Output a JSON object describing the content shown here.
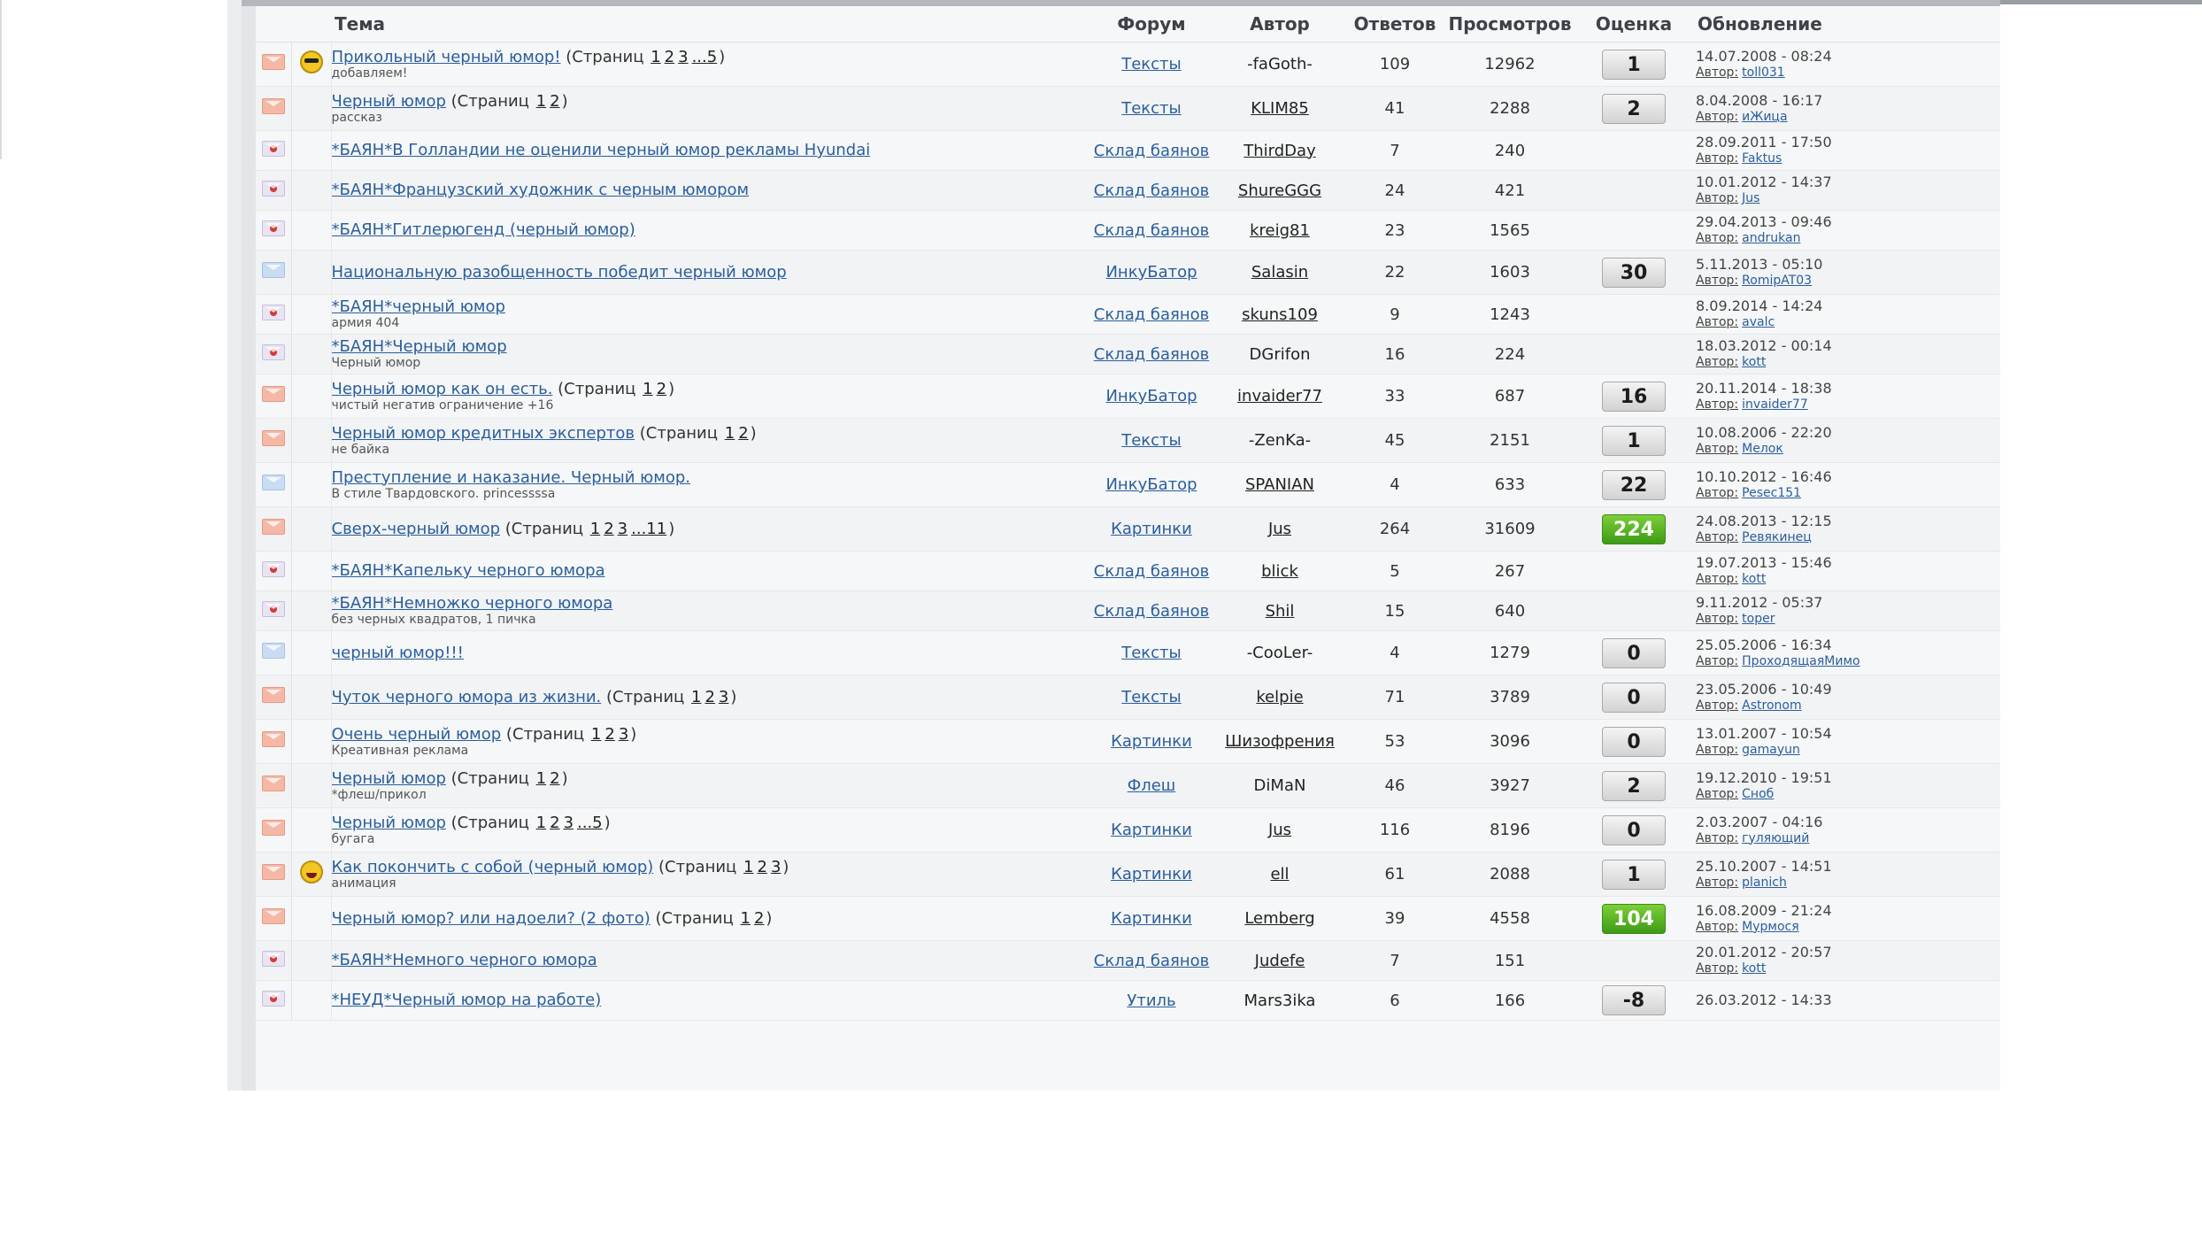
{
  "table": {
    "headers": {
      "topic": "Тема",
      "forum": "Форум",
      "author": "Автор",
      "replies": "Ответов",
      "views": "Просмотров",
      "rating": "Оценка",
      "updated": "Обновление"
    },
    "pages_word": "(Страниц",
    "author_prefix": "Автор:",
    "rows": [
      {
        "icon": "hot",
        "emoji": "cool",
        "title": "Прикольный черный юмор!",
        "pages": [
          "1",
          "2",
          "3",
          "...5"
        ],
        "subtitle": "добавляем!",
        "forum": "Тексты",
        "author": "-faGoth-",
        "author_link": false,
        "replies": "109",
        "views": "12962",
        "rating": "1",
        "rating_style": "gray",
        "updated": "14.07.2008 - 08:24",
        "updated_by": "toll031"
      },
      {
        "icon": "hot",
        "emoji": "",
        "title": "Черный юмор",
        "pages": [
          "1",
          "2"
        ],
        "subtitle": "рассказ",
        "forum": "Тексты",
        "author": "KLIM85",
        "author_link": true,
        "replies": "41",
        "views": "2288",
        "rating": "2",
        "rating_style": "gray",
        "updated": "8.04.2008 - 16:17",
        "updated_by": "иЖица"
      },
      {
        "icon": "moved",
        "emoji": "",
        "title": "*БАЯН*В Голландии не оценили черный юмор рекламы Hyundai",
        "pages": [],
        "subtitle": "",
        "forum": "Склад баянов",
        "author": "ThirdDay",
        "author_link": true,
        "replies": "7",
        "views": "240",
        "rating": "",
        "rating_style": "",
        "updated": "28.09.2011 - 17:50",
        "updated_by": "Faktus"
      },
      {
        "icon": "moved",
        "emoji": "",
        "title": "*БАЯН*Французский художник с черным юмором",
        "pages": [],
        "subtitle": "",
        "forum": "Склад баянов",
        "author": "ShureGGG",
        "author_link": true,
        "replies": "24",
        "views": "421",
        "rating": "",
        "rating_style": "",
        "updated": "10.01.2012 - 14:37",
        "updated_by": "Jus"
      },
      {
        "icon": "moved",
        "emoji": "",
        "title": "*БАЯН*Гитлерюгенд (черный юмор)",
        "pages": [],
        "subtitle": "",
        "forum": "Склад баянов",
        "author": "kreig81",
        "author_link": true,
        "replies": "23",
        "views": "1565",
        "rating": "",
        "rating_style": "",
        "updated": "29.04.2013 - 09:46",
        "updated_by": "andrukan"
      },
      {
        "icon": "new",
        "emoji": "",
        "title": "Национальную разобщенность победит черный юмор",
        "pages": [],
        "subtitle": "",
        "forum": "ИнкуБатор",
        "author": "Salasin",
        "author_link": true,
        "replies": "22",
        "views": "1603",
        "rating": "30",
        "rating_style": "gray",
        "updated": "5.11.2013 - 05:10",
        "updated_by": "RomipAT03"
      },
      {
        "icon": "moved",
        "emoji": "",
        "title": "*БАЯН*черный юмор",
        "pages": [],
        "subtitle": "армия 404",
        "forum": "Склад баянов",
        "author": "skuns109",
        "author_link": true,
        "replies": "9",
        "views": "1243",
        "rating": "",
        "rating_style": "",
        "updated": "8.09.2014 - 14:24",
        "updated_by": "avalc"
      },
      {
        "icon": "moved",
        "emoji": "",
        "title": "*БАЯН*Черный юмор",
        "pages": [],
        "subtitle": "Черный юмор",
        "forum": "Склад баянов",
        "author": "DGrifon",
        "author_link": false,
        "replies": "16",
        "views": "224",
        "rating": "",
        "rating_style": "",
        "updated": "18.03.2012 - 00:14",
        "updated_by": "kott"
      },
      {
        "icon": "hot",
        "emoji": "",
        "title": "Черный юмор как он есть.",
        "pages": [
          "1",
          "2"
        ],
        "subtitle": "чистый негатив ограничение +16",
        "forum": "ИнкуБатор",
        "author": "invaider77",
        "author_link": true,
        "replies": "33",
        "views": "687",
        "rating": "16",
        "rating_style": "gray",
        "updated": "20.11.2014 - 18:38",
        "updated_by": "invaider77"
      },
      {
        "icon": "hot",
        "emoji": "",
        "title": "Черный юмор кредитных экспертов",
        "pages": [
          "1",
          "2"
        ],
        "subtitle": "не байка",
        "forum": "Тексты",
        "author": "-ZenKa-",
        "author_link": false,
        "replies": "45",
        "views": "2151",
        "rating": "1",
        "rating_style": "gray",
        "updated": "10.08.2006 - 22:20",
        "updated_by": "Мелок"
      },
      {
        "icon": "new",
        "emoji": "",
        "title": "Преступление и наказание. Черный юмор.",
        "pages": [],
        "subtitle": "В стиле Твардовского. princessssa",
        "forum": "ИнкуБатор",
        "author": "SPANIAN",
        "author_link": true,
        "replies": "4",
        "views": "633",
        "rating": "22",
        "rating_style": "gray",
        "updated": "10.10.2012 - 16:46",
        "updated_by": "Pesec151"
      },
      {
        "icon": "hot",
        "emoji": "",
        "title": "Сверх-черный юмор",
        "pages": [
          "1",
          "2",
          "3",
          "...11"
        ],
        "subtitle": "",
        "forum": "Картинки",
        "author": "Jus",
        "author_link": true,
        "replies": "264",
        "views": "31609",
        "rating": "224",
        "rating_style": "green",
        "updated": "24.08.2013 - 12:15",
        "updated_by": "Ревякинец"
      },
      {
        "icon": "moved",
        "emoji": "",
        "title": "*БАЯН*Капельку черного юмора",
        "pages": [],
        "subtitle": "",
        "forum": "Склад баянов",
        "author": "blick",
        "author_link": true,
        "replies": "5",
        "views": "267",
        "rating": "",
        "rating_style": "",
        "updated": "19.07.2013 - 15:46",
        "updated_by": "kott"
      },
      {
        "icon": "moved",
        "emoji": "",
        "title": "*БАЯН*Немножко черного юмора",
        "pages": [],
        "subtitle": "без черных квадратов, 1 пичка",
        "forum": "Склад баянов",
        "author": "Shil",
        "author_link": true,
        "replies": "15",
        "views": "640",
        "rating": "",
        "rating_style": "",
        "updated": "9.11.2012 - 05:37",
        "updated_by": "toper"
      },
      {
        "icon": "new",
        "emoji": "",
        "title": "черный юмор!!!",
        "pages": [],
        "subtitle": "",
        "forum": "Тексты",
        "author": "-CooLer-",
        "author_link": false,
        "replies": "4",
        "views": "1279",
        "rating": "0",
        "rating_style": "gray",
        "updated": "25.05.2006 - 16:34",
        "updated_by": "ПроходящаяМимо"
      },
      {
        "icon": "hot",
        "emoji": "",
        "title": "Чуток черного юмора из жизни.",
        "pages": [
          "1",
          "2",
          "3"
        ],
        "subtitle": "",
        "forum": "Тексты",
        "author": "kelpie",
        "author_link": true,
        "replies": "71",
        "views": "3789",
        "rating": "0",
        "rating_style": "gray",
        "updated": "23.05.2006 - 10:49",
        "updated_by": "Astronom"
      },
      {
        "icon": "hot",
        "emoji": "",
        "title": "Очень черный юмор",
        "pages": [
          "1",
          "2",
          "3"
        ],
        "subtitle": "Креативная реклама",
        "forum": "Картинки",
        "author": "Шизофрения",
        "author_link": true,
        "replies": "53",
        "views": "3096",
        "rating": "0",
        "rating_style": "gray",
        "updated": "13.01.2007 - 10:54",
        "updated_by": "gamayun"
      },
      {
        "icon": "hot",
        "emoji": "",
        "title": "Черный юмор",
        "pages": [
          "1",
          "2"
        ],
        "subtitle": "*флеш/прикол",
        "forum": "Флеш",
        "author": "DiMaN",
        "author_link": false,
        "replies": "46",
        "views": "3927",
        "rating": "2",
        "rating_style": "gray",
        "updated": "19.12.2010 - 19:51",
        "updated_by": "Сноб"
      },
      {
        "icon": "hot",
        "emoji": "",
        "title": "Черный юмор",
        "pages": [
          "1",
          "2",
          "3",
          "...5"
        ],
        "subtitle": "бугага",
        "forum": "Картинки",
        "author": "Jus",
        "author_link": true,
        "replies": "116",
        "views": "8196",
        "rating": "0",
        "rating_style": "gray",
        "updated": "2.03.2007 - 04:16",
        "updated_by": "гуляющий"
      },
      {
        "icon": "hot",
        "emoji": "laugh",
        "title": "Как покончить с собой (черный юмор)",
        "pages": [
          "1",
          "2",
          "3"
        ],
        "subtitle": "анимация",
        "forum": "Картинки",
        "author": "ell",
        "author_link": true,
        "replies": "61",
        "views": "2088",
        "rating": "1",
        "rating_style": "gray",
        "updated": "25.10.2007 - 14:51",
        "updated_by": "planich"
      },
      {
        "icon": "hot",
        "emoji": "",
        "title": "Черный юмор? или надоели? (2 фото)",
        "pages": [
          "1",
          "2"
        ],
        "subtitle": "",
        "forum": "Картинки",
        "author": "Lemberg",
        "author_link": true,
        "replies": "39",
        "views": "4558",
        "rating": "104",
        "rating_style": "green",
        "updated": "16.08.2009 - 21:24",
        "updated_by": "Мурмося"
      },
      {
        "icon": "moved",
        "emoji": "",
        "title": "*БАЯН*Немного черного юмора",
        "pages": [],
        "subtitle": "",
        "forum": "Склад баянов",
        "author": "Judefe",
        "author_link": true,
        "replies": "7",
        "views": "151",
        "rating": "",
        "rating_style": "",
        "updated": "20.01.2012 - 20:57",
        "updated_by": "kott"
      },
      {
        "icon": "moved",
        "emoji": "",
        "title": "*НЕУД*Черный юмор на работе)",
        "pages": [],
        "subtitle": "",
        "forum": "Утиль",
        "author": "Mars3ika",
        "author_link": false,
        "replies": "6",
        "views": "166",
        "rating": "-8",
        "rating_style": "gray",
        "updated": "26.03.2012 - 14:33",
        "updated_by": ""
      }
    ]
  }
}
